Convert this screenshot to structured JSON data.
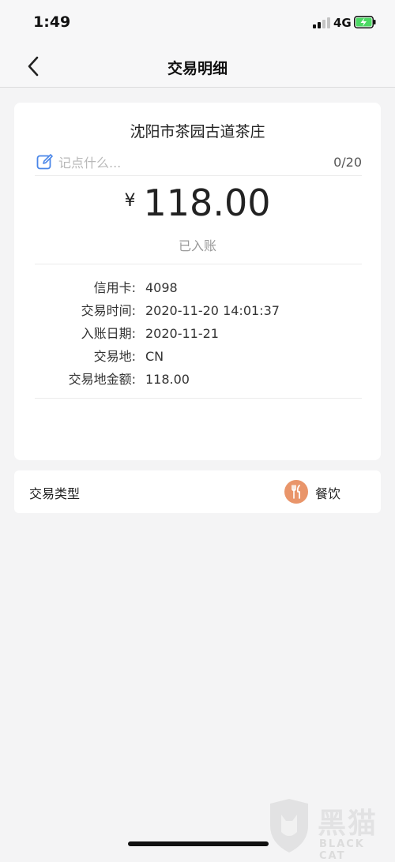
{
  "status_bar": {
    "time": "1:49",
    "network": "4G",
    "battery_color": "#4cd964"
  },
  "nav": {
    "title": "交易明细",
    "back_icon": "chevron-left-icon"
  },
  "transaction": {
    "merchant": "沈阳市茶园古道茶庄",
    "note": {
      "placeholder": "记点什么...",
      "value": "",
      "counter": "0/20",
      "icon": "edit-icon",
      "icon_color": "#4a86e8"
    },
    "currency_symbol": "¥",
    "amount": "118.00",
    "status": "已入账",
    "details": [
      {
        "label": "信用卡:",
        "value": "4098"
      },
      {
        "label": "交易时间:",
        "value": "2020-11-20 14:01:37"
      },
      {
        "label": "入账日期:",
        "value": "2020-11-21"
      },
      {
        "label": "交易地:",
        "value": "CN"
      },
      {
        "label": "交易地金额:",
        "value": "118.00"
      }
    ]
  },
  "category": {
    "label": "交易类型",
    "value": "餐饮",
    "icon": "utensils-icon",
    "icon_color": "#e9956a"
  },
  "watermark": {
    "text": "黑猫",
    "subtext": "BLACK CAT"
  }
}
